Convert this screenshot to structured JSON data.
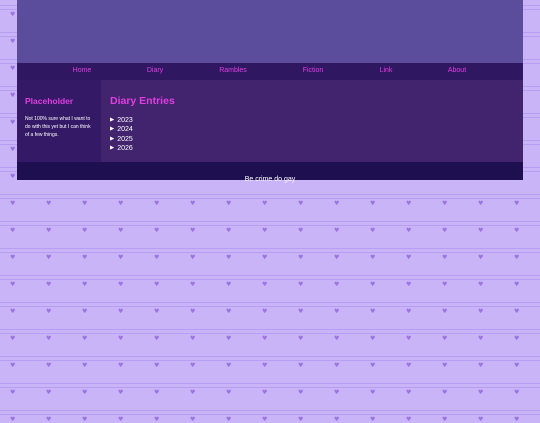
{
  "nav": {
    "items": [
      {
        "label": "Home"
      },
      {
        "label": "Diary"
      },
      {
        "label": "Rambles"
      },
      {
        "label": "Fiction"
      },
      {
        "label": "Link"
      },
      {
        "label": "About"
      }
    ]
  },
  "sidebar": {
    "title": "Placeholder",
    "text": "Not 100% sure what I want to do with this yet but I can think of a few things."
  },
  "main": {
    "title": "Diary Entries",
    "years": [
      "2023",
      "2024",
      "2025",
      "2026"
    ]
  },
  "footer": {
    "text": "Be crime do gay"
  },
  "colors": {
    "accent": "#e03ee0",
    "nav_bg": "#2f1861",
    "main_bg": "#42236e",
    "header_bg": "#5c4c9c",
    "page_bg": "#c8b4f6"
  }
}
